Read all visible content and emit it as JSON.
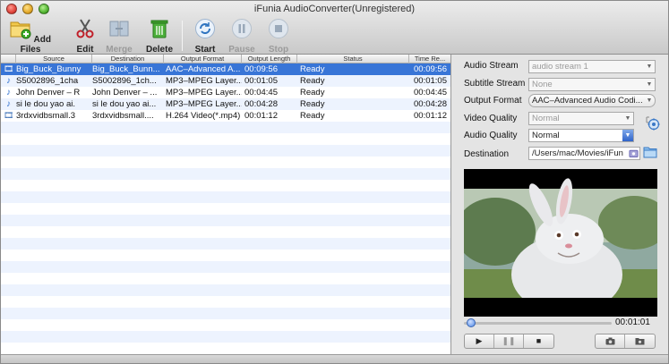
{
  "window": {
    "title": "iFunia AudioConverter(Unregistered)"
  },
  "toolbar": {
    "add_files": "Add Files",
    "edit": "Edit",
    "merge": "Merge",
    "delete": "Delete",
    "start": "Start",
    "pause": "Pause",
    "stop": "Stop"
  },
  "table": {
    "columns": [
      "Source",
      "Destination",
      "Output Format",
      "Output Length",
      "Status",
      "Time Re..."
    ],
    "rows": [
      {
        "source": "Big_Buck_Bunny",
        "destination": "Big_Buck_Bunn...",
        "format": "AAC–Advanced A...",
        "length": "00:09:56",
        "status": "Ready",
        "time": "00:09:56",
        "icon": "film-icon",
        "selected": true
      },
      {
        "source": "S5002896_1cha",
        "destination": "S5002896_1ch...",
        "format": "MP3–MPEG Layer...",
        "length": "00:01:05",
        "status": "Ready",
        "time": "00:01:05",
        "icon": "music-note-icon"
      },
      {
        "source": "John Denver – R",
        "destination": "John Denver – ...",
        "format": "MP3–MPEG Layer...",
        "length": "00:04:45",
        "status": "Ready",
        "time": "00:04:45",
        "icon": "music-note-icon"
      },
      {
        "source": "si le dou yao ai.",
        "destination": "si le dou yao ai...",
        "format": "MP3–MPEG Layer...",
        "length": "00:04:28",
        "status": "Ready",
        "time": "00:04:28",
        "icon": "music-note-icon"
      },
      {
        "source": "3rdxvidbsmall.3",
        "destination": "3rdxvidbsmall....",
        "format": "H.264 Video(*.mp4)",
        "length": "00:01:12",
        "status": "Ready",
        "time": "00:01:12",
        "icon": "film-icon"
      }
    ]
  },
  "settings": {
    "audio_stream_label": "Audio Stream",
    "audio_stream_value": "audio stream 1",
    "subtitle_stream_label": "Subtitle Stream",
    "subtitle_stream_value": "None",
    "output_format_label": "Output Format",
    "output_format_value": "AAC–Advanced Audio Codi...",
    "video_quality_label": "Video Quality",
    "video_quality_value": "Normal",
    "audio_quality_label": "Audio Quality",
    "audio_quality_value": "Normal",
    "destination_label": "Destination",
    "destination_value": "/Users/mac/Movies/iFun"
  },
  "player": {
    "timecode": "00:01:01",
    "progress": 0.02
  },
  "colors": {
    "selection": "#3875d7",
    "alt_row": "#edf3fe"
  }
}
